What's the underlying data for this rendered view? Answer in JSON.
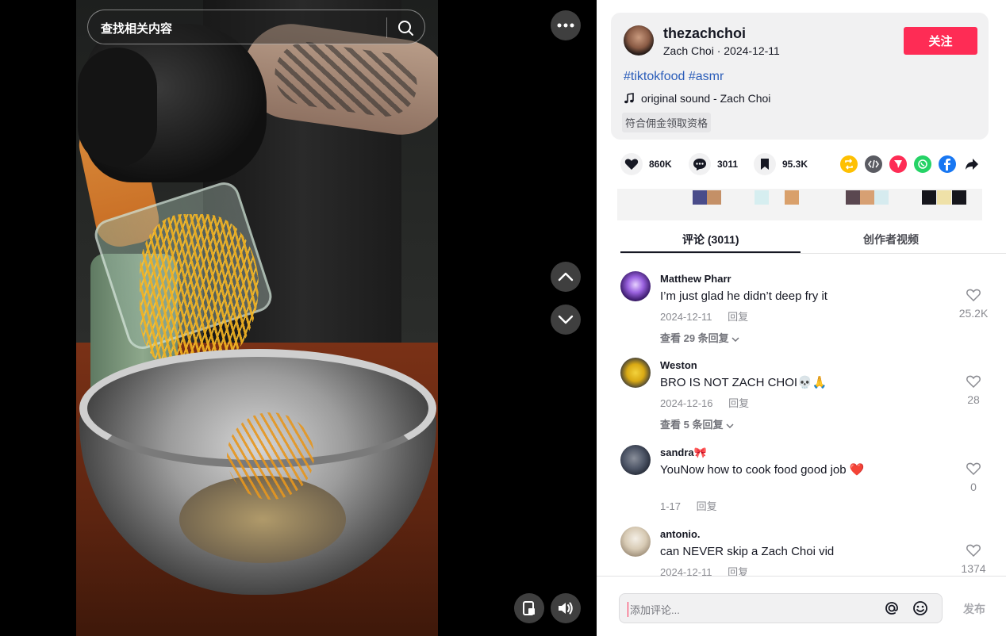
{
  "search": {
    "placeholder": "查找相关内容"
  },
  "author": {
    "username": "thezachchoi",
    "display_name": "Zach Choi",
    "date": "2024-12-11",
    "follow_label": "关注",
    "hashtags": "#tiktokfood #asmr",
    "music": "original sound - Zach Choi",
    "tag": "符合佣金领取资格"
  },
  "stats": {
    "likes": "860K",
    "comments": "3011",
    "saves": "95.3K"
  },
  "share_icons": [
    "repost-icon",
    "embed-icon",
    "send-icon",
    "whatsapp-icon",
    "facebook-icon",
    "share-arrow-icon"
  ],
  "tabs": {
    "comments": "评论 (3011)",
    "creator_videos": "创作者视频"
  },
  "comments": [
    {
      "user": "Matthew Pharr",
      "text": "I’m just glad he didn’t deep fry it",
      "date": "2024-12-11",
      "reply": "回复",
      "likes": "25.2K",
      "more": "查看 29 条回复"
    },
    {
      "user": "Weston",
      "text": "BRO IS NOT ZACH CHOI💀🙏",
      "date": "2024-12-16",
      "reply": "回复",
      "likes": "28",
      "more": "查看 5 条回复"
    },
    {
      "user": "sandra🎀",
      "text": "YouNow how to cook food good job ❤️",
      "date": "1-17",
      "reply": "回复",
      "likes": "0"
    },
    {
      "user": "antonio.",
      "text": "can NEVER skip a Zach Choi vid",
      "date": "2024-12-11",
      "reply": "回复",
      "likes": "1374"
    }
  ],
  "comment_input": {
    "placeholder": "添加评论..."
  },
  "post_label": "发布",
  "colors": {
    "accent": "#fe2c55",
    "link": "#2b5db9"
  }
}
